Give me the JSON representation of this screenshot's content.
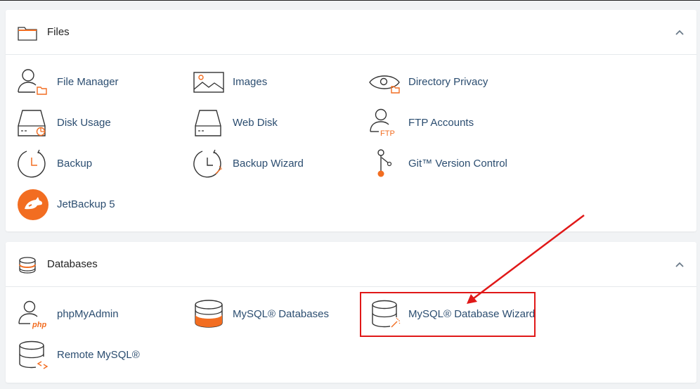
{
  "colors": {
    "accent": "#f26d21",
    "link": "#2b4d70",
    "annotation": "#e01818"
  },
  "files": {
    "title": "Files",
    "items": [
      {
        "label": "File Manager",
        "icon": "file-manager-icon"
      },
      {
        "label": "Images",
        "icon": "images-icon"
      },
      {
        "label": "Directory Privacy",
        "icon": "directory-privacy-icon"
      },
      {
        "label": "Disk Usage",
        "icon": "disk-usage-icon"
      },
      {
        "label": "Web Disk",
        "icon": "web-disk-icon"
      },
      {
        "label": "FTP Accounts",
        "icon": "ftp-accounts-icon"
      },
      {
        "label": "Backup",
        "icon": "backup-icon"
      },
      {
        "label": "Backup Wizard",
        "icon": "backup-wizard-icon"
      },
      {
        "label": "Git™ Version Control",
        "icon": "git-icon"
      },
      {
        "label": "JetBackup 5",
        "icon": "jetbackup-icon"
      }
    ]
  },
  "databases": {
    "title": "Databases",
    "items": [
      {
        "label": "phpMyAdmin",
        "icon": "phpmyadmin-icon"
      },
      {
        "label": "MySQL® Databases",
        "icon": "mysql-databases-icon"
      },
      {
        "label": "MySQL® Database Wizard",
        "icon": "mysql-wizard-icon"
      },
      {
        "label": "Remote MySQL®",
        "icon": "remote-mysql-icon"
      }
    ]
  },
  "icon_text": {
    "ftp": "FTP",
    "php": "php"
  }
}
